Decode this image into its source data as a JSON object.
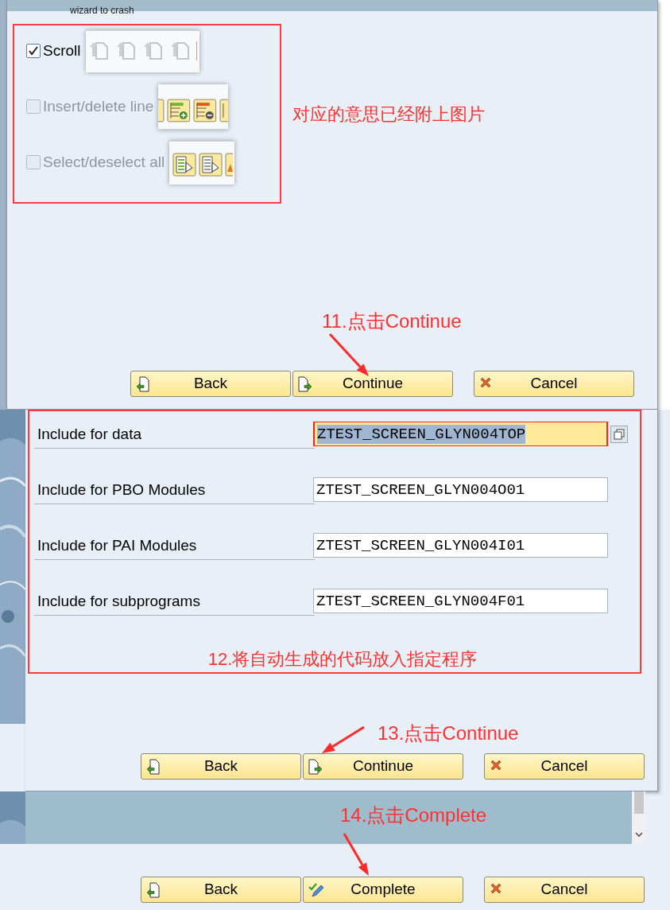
{
  "top_window": {
    "caption": "wizard to crash"
  },
  "dialog_1": {
    "options": [
      {
        "label": "Scroll",
        "checked": true,
        "disabled": false,
        "kind": "scroll"
      },
      {
        "label": "Insert/delete line",
        "checked": false,
        "disabled": true,
        "kind": "insert_delete"
      },
      {
        "label": "Select/deselect all",
        "checked": false,
        "disabled": true,
        "kind": "select"
      }
    ],
    "note": "对应的意思已经附上图片",
    "step_note": "11.点击Continue",
    "buttons": [
      {
        "label": "Back",
        "kind": "back"
      },
      {
        "label": "Continue",
        "kind": "continue"
      },
      {
        "label": "Cancel",
        "kind": "cancel"
      }
    ]
  },
  "dialog_2": {
    "fields": [
      {
        "label": "Include for data",
        "value": "ZTEST_SCREEN_GLYN004TOP",
        "selected": true
      },
      {
        "label": "Include for PBO Modules",
        "value": "ZTEST_SCREEN_GLYN004O01",
        "selected": false
      },
      {
        "label": "Include for PAI Modules",
        "value": "ZTEST_SCREEN_GLYN004I01",
        "selected": false
      },
      {
        "label": "Include for subprograms",
        "value": "ZTEST_SCREEN_GLYN004F01",
        "selected": false
      }
    ],
    "note": "12.将自动生成的代码放入指定程序",
    "step_note": "13.点击Continue",
    "buttons": [
      {
        "label": "Back",
        "kind": "back"
      },
      {
        "label": "Continue",
        "kind": "continue"
      },
      {
        "label": "Cancel",
        "kind": "cancel"
      }
    ]
  },
  "dialog_3": {
    "step_note": "14.点击Complete",
    "buttons": [
      {
        "label": "Back",
        "kind": "back"
      },
      {
        "label": "Complete",
        "kind": "complete"
      },
      {
        "label": "Cancel",
        "kind": "cancel"
      }
    ]
  }
}
